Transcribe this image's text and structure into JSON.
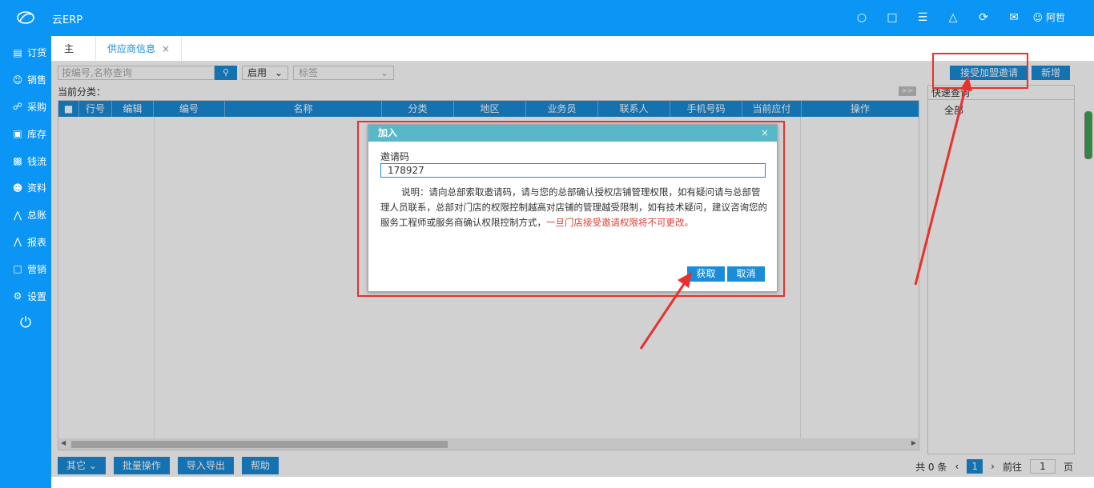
{
  "app": {
    "brand": "云ERP",
    "user": "阿哲"
  },
  "topbar": {
    "icons": [
      "bulb-icon",
      "check-square-icon",
      "menu-icon",
      "shirt-icon",
      "refresh-icon",
      "mail-icon"
    ]
  },
  "sidebar": {
    "items": [
      {
        "label": "订货",
        "icon": "clipboard-icon"
      },
      {
        "label": "销售",
        "icon": "person-icon"
      },
      {
        "label": "采购",
        "icon": "cart-icon"
      },
      {
        "label": "库存",
        "icon": "warehouse-icon"
      },
      {
        "label": "钱流",
        "icon": "money-box-icon"
      },
      {
        "label": "资料",
        "icon": "contacts-icon"
      },
      {
        "label": "总账",
        "icon": "chart-icon"
      },
      {
        "label": "报表",
        "icon": "report-icon"
      },
      {
        "label": "营销",
        "icon": "marketing-icon"
      },
      {
        "label": "设置",
        "icon": "gear-icon"
      }
    ]
  },
  "tabs": {
    "home": "主页",
    "active": "供应商信息"
  },
  "toolbar": {
    "search_placeholder": "按编号,名称查询",
    "status_value": "启用",
    "tags_placeholder": "标签",
    "invite_button": "接受加盟邀请",
    "new_button": "新增"
  },
  "classification_label": "当前分类：",
  "grid": {
    "columns": [
      "行号",
      "编辑",
      "编号",
      "名称",
      "分类",
      "地区",
      "业务员",
      "联系人",
      "手机号码",
      "当前应付",
      "操作"
    ]
  },
  "quick_query": {
    "title": "快速查询",
    "item": "全部"
  },
  "bottom": {
    "buttons": [
      "其它",
      "批量操作",
      "导入导出",
      "帮助"
    ],
    "total": "共 0 条",
    "current_page": "1",
    "goto_label": "前往",
    "goto_value": "1",
    "page_suffix": "页"
  },
  "dialog": {
    "title": "加入",
    "label": "邀请码",
    "code_value": "178927",
    "note": "说明：请向总部索取邀请码，请与您的总部确认授权店铺管理权限，如有疑问请与总部管理人员联系，总部对门店的权限控制越高对店铺的管理越受限制，如有技术疑问，建议咨询您的服务工程师或服务商确认权限控制方式，",
    "warning": "一旦门店接受邀请权限将不可更改。",
    "ok_button": "获取",
    "cancel_button": "取消"
  }
}
